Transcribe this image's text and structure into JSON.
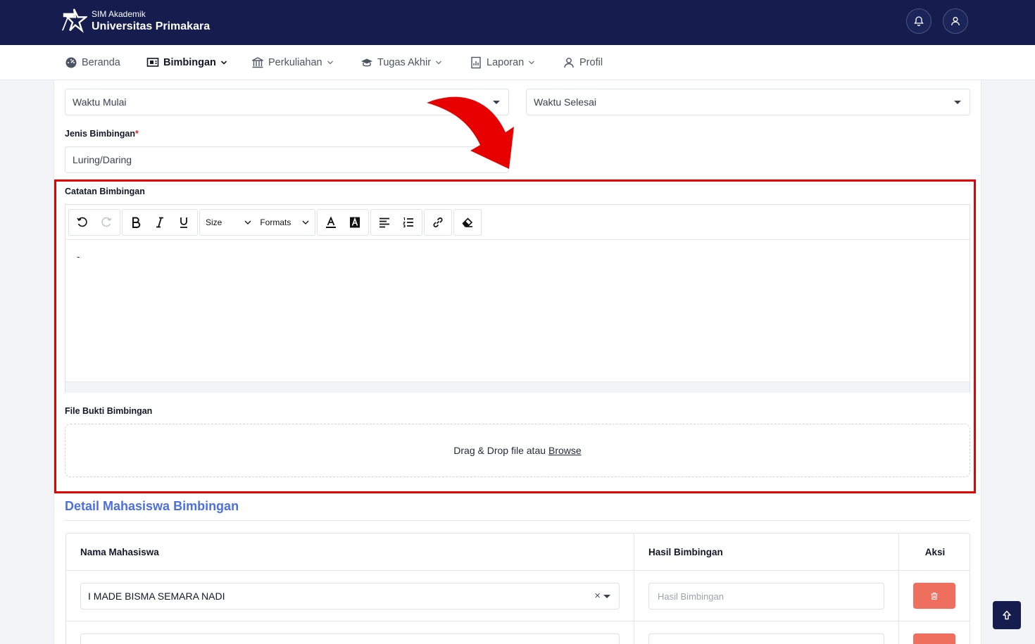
{
  "header": {
    "app_subtitle": "SIM Akademik",
    "app_title": "Universitas Primakara",
    "brand_color": "#141d4e"
  },
  "nav": {
    "items": [
      {
        "label": "Beranda",
        "icon": "dashboard-icon",
        "active": false,
        "dropdown": false
      },
      {
        "label": "Bimbingan",
        "icon": "presentation-icon",
        "active": true,
        "dropdown": true
      },
      {
        "label": "Perkuliahan",
        "icon": "university-icon",
        "active": false,
        "dropdown": true
      },
      {
        "label": "Tugas Akhir",
        "icon": "graduation-cap-icon",
        "active": false,
        "dropdown": true
      },
      {
        "label": "Laporan",
        "icon": "report-icon",
        "active": false,
        "dropdown": true
      },
      {
        "label": "Profil",
        "icon": "user-icon",
        "active": false,
        "dropdown": false
      }
    ]
  },
  "form": {
    "waktu_mulai_placeholder": "Waktu Mulai",
    "waktu_selesai_placeholder": "Waktu Selesai",
    "jenis_label": "Jenis Bimbingan",
    "required_mark": "*",
    "jenis_value": "Luring/Daring",
    "catatan_label": "Catatan Bimbingan",
    "editor_toolbar": {
      "size_label": "Size",
      "formats_label": "Formats"
    },
    "editor_content": "-",
    "file_label": "File Bukti Bimbingan",
    "dropzone_text": "Drag & Drop file atau",
    "dropzone_browse": "Browse"
  },
  "detail": {
    "title": "Detail Mahasiswa Bimbingan",
    "title_color": "#4c6fe5",
    "columns": [
      "Nama Mahasiswa",
      "Hasil Bimbingan",
      "Aksi"
    ],
    "rows": [
      {
        "nama": "I MADE BISMA SEMARA NADI",
        "hasil_placeholder": "Hasil Bimbingan"
      }
    ],
    "delete_color": "#ef6f5f"
  },
  "annotation_color": "#e60000"
}
